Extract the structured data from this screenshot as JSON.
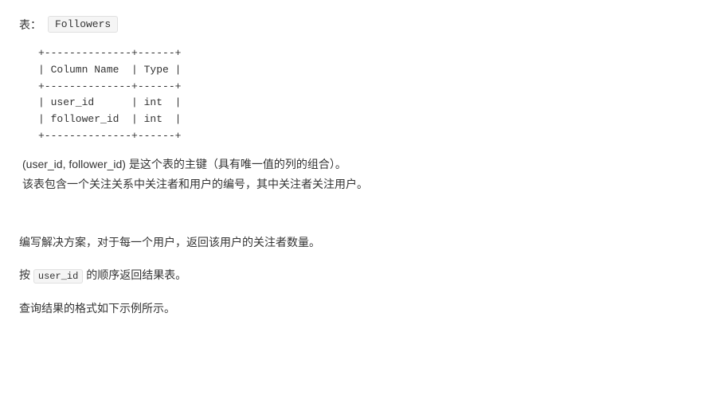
{
  "header": {
    "table_label": "表：",
    "table_name": "Followers"
  },
  "schema": {
    "lines": [
      "+--------------+------+",
      "| Column Name  | Type |",
      "+--------------+------+",
      "| user_id      | int  |",
      "| follower_id  | int  |",
      "+--------------+------+"
    ]
  },
  "description": {
    "line1": "(user_id, follower_id) 是这个表的主键（具有唯一值的列的组合）。",
    "line2": "该表包含一个关注关系中关注者和用户的编号，其中关注者关注用户。"
  },
  "task": {
    "line1": "编写解决方案，对于每一个用户，返回该用户的关注者数量。",
    "line2_prefix": "按 ",
    "line2_code": "user_id",
    "line2_suffix": " 的顺序返回结果表。",
    "line3": "查询结果的格式如下示例所示。"
  }
}
